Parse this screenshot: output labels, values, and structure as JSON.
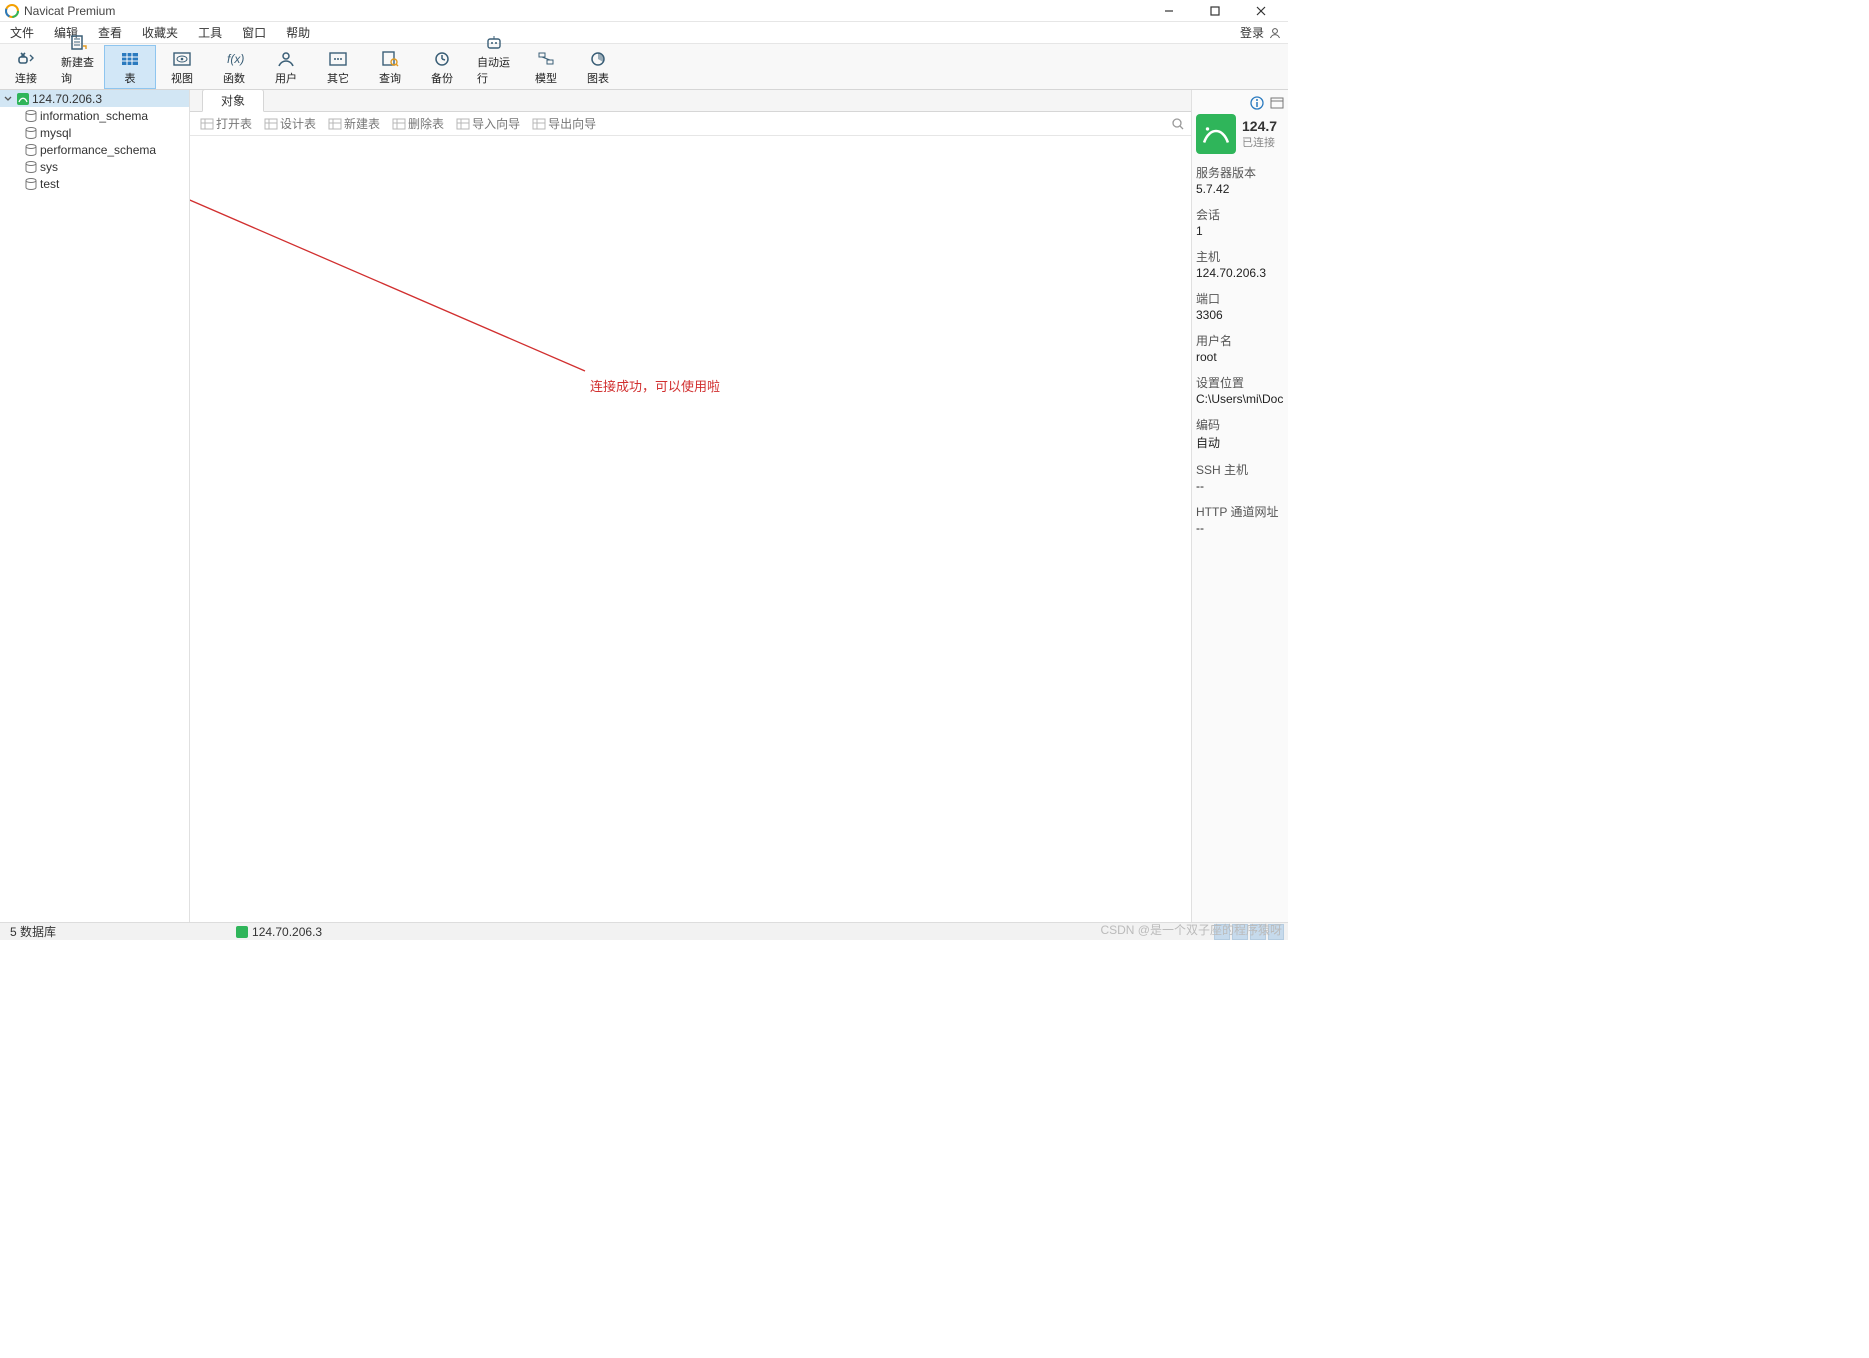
{
  "app": {
    "title": "Navicat Premium"
  },
  "menu": {
    "items": [
      "文件",
      "编辑",
      "查看",
      "收藏夹",
      "工具",
      "窗口",
      "帮助"
    ],
    "login": "登录"
  },
  "toolbar": {
    "items": [
      {
        "label": "连接",
        "name": "connect-button",
        "icon": "plug"
      },
      {
        "label": "新建查询",
        "name": "new-query-button",
        "icon": "sheet"
      },
      {
        "label": "表",
        "name": "table-button",
        "icon": "grid",
        "active": true
      },
      {
        "label": "视图",
        "name": "view-button",
        "icon": "eye"
      },
      {
        "label": "函数",
        "name": "function-button",
        "icon": "fx"
      },
      {
        "label": "用户",
        "name": "user-button",
        "icon": "user"
      },
      {
        "label": "其它",
        "name": "other-button",
        "icon": "dots"
      },
      {
        "label": "查询",
        "name": "query-button",
        "icon": "search"
      },
      {
        "label": "备份",
        "name": "backup-button",
        "icon": "clock"
      },
      {
        "label": "自动运行",
        "name": "automation-button",
        "icon": "robot"
      },
      {
        "label": "模型",
        "name": "model-button",
        "icon": "model"
      },
      {
        "label": "图表",
        "name": "chart-button",
        "icon": "chart"
      }
    ]
  },
  "tree": {
    "root": {
      "label": "124.70.206.3"
    },
    "children": [
      {
        "label": "information_schema"
      },
      {
        "label": "mysql"
      },
      {
        "label": "performance_schema"
      },
      {
        "label": "sys"
      },
      {
        "label": "test"
      }
    ]
  },
  "tabs": {
    "active": "对象"
  },
  "subtoolbar": {
    "items": [
      {
        "label": "打开表",
        "name": "open-table-button"
      },
      {
        "label": "设计表",
        "name": "design-table-button"
      },
      {
        "label": "新建表",
        "name": "new-table-button"
      },
      {
        "label": "删除表",
        "name": "delete-table-button"
      },
      {
        "label": "导入向导",
        "name": "import-wizard-button"
      },
      {
        "label": "导出向导",
        "name": "export-wizard-button"
      }
    ]
  },
  "annotation": {
    "text": "连接成功，可以使用啦"
  },
  "info": {
    "conn_title": "124.7",
    "conn_status": "已连接",
    "rows": [
      {
        "k": "服务器版本",
        "v": "5.7.42"
      },
      {
        "k": "会话",
        "v": "1"
      },
      {
        "k": "主机",
        "v": "124.70.206.3"
      },
      {
        "k": "端口",
        "v": "3306"
      },
      {
        "k": "用户名",
        "v": "root"
      },
      {
        "k": "设置位置",
        "v": "C:\\Users\\mi\\Docu"
      },
      {
        "k": "编码",
        "v": "自动"
      },
      {
        "k": "SSH 主机",
        "v": "--"
      },
      {
        "k": "HTTP 通道网址",
        "v": "--"
      }
    ]
  },
  "status": {
    "left": "5 数据库",
    "conn": "124.70.206.3",
    "watermark": "CSDN @是一个双子座的程序猿呀"
  },
  "colors": {
    "accent": "#2a7abf",
    "treeSel": "#d2e6f4",
    "toolbarSel": "#d2e7f7"
  }
}
